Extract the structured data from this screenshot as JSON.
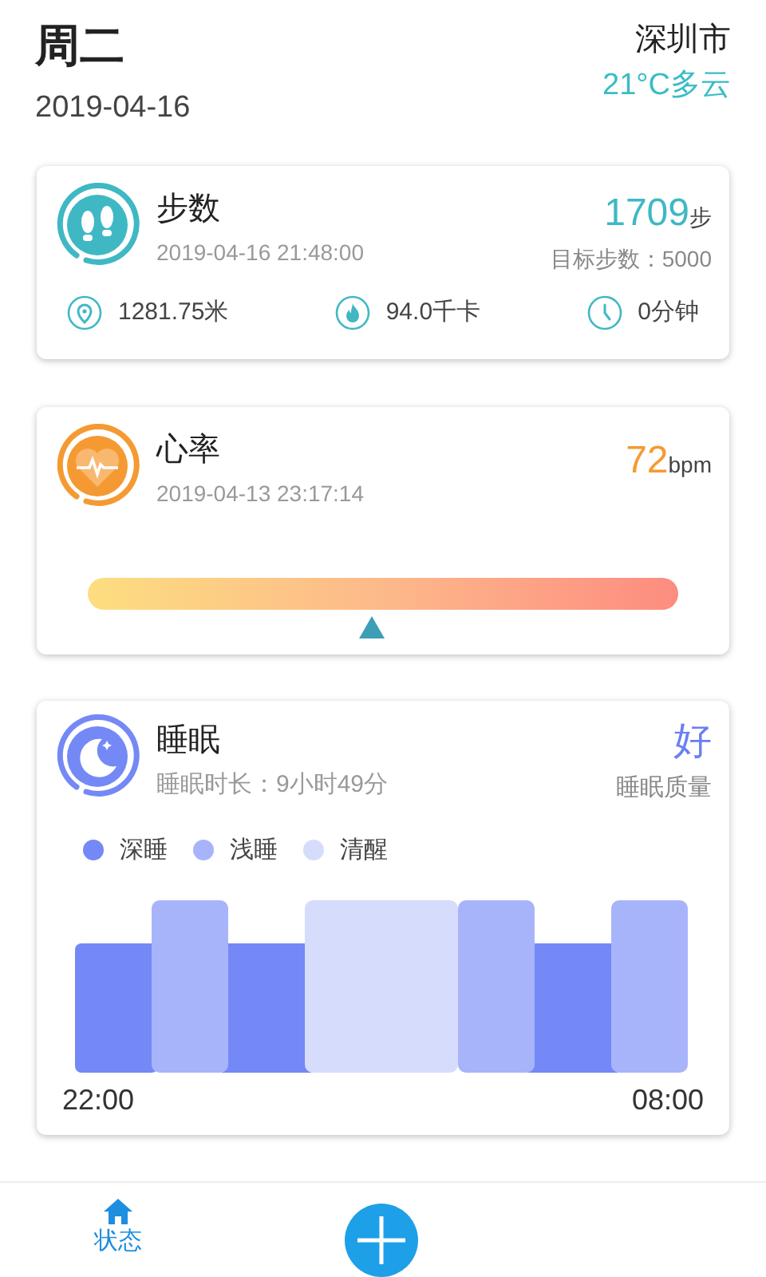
{
  "header": {
    "weekday": "周二",
    "date": "2019-04-16",
    "city": "深圳市",
    "weather": "21°C多云"
  },
  "steps": {
    "title": "步数",
    "time": "2019-04-16 21:48:00",
    "value": "1709",
    "unit": "步",
    "goal": "目标步数：5000",
    "stats": [
      {
        "kind": "distance",
        "text": "1281.75米"
      },
      {
        "kind": "calories",
        "text": "94.0千卡"
      },
      {
        "kind": "duration",
        "text": "0分钟"
      }
    ]
  },
  "heart_rate": {
    "title": "心率",
    "time": "2019-04-13 23:17:14",
    "value": "72",
    "unit": "bpm"
  },
  "sleep": {
    "title": "睡眠",
    "duration": "睡眠时长：9小时49分",
    "quality": "好",
    "quality_label": "睡眠质量",
    "legend": [
      {
        "label": "深睡",
        "color": "#7489f5"
      },
      {
        "label": "浅睡",
        "color": "#a8b4fa"
      },
      {
        "label": "清醒",
        "color": "#d6dcfb"
      }
    ],
    "start": "22:00",
    "end": "08:00"
  },
  "bottom_nav": {
    "tabs": [
      {
        "label": "状态",
        "selected": true
      }
    ]
  }
}
